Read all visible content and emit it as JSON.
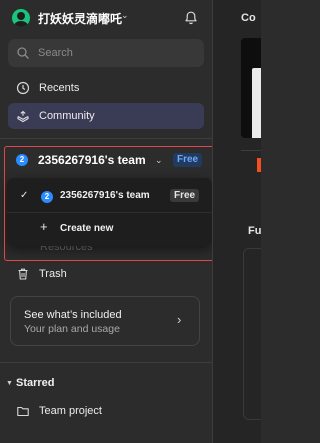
{
  "header": {
    "username": "打妖妖灵滴嘟吒",
    "username_chevron": "⌄"
  },
  "search": {
    "placeholder": "Search"
  },
  "nav": {
    "recents": "Recents",
    "community": "Community"
  },
  "team": {
    "badge_number": "2",
    "name": "2356267916's team",
    "chevron": "⌄",
    "plan_badge": "Free",
    "accent": "#2b8cff"
  },
  "team_dropdown": {
    "selected_check": "✓",
    "team_badge_number": "2",
    "team_name": "2356267916's team",
    "plan_badge": "Free",
    "create_icon": "+",
    "create_label": "Create new"
  },
  "partially_hidden_item": "Resources",
  "trash": "Trash",
  "promo_card": {
    "title": "See what’s included",
    "subtitle": "Your plan and usage",
    "chevron": "›"
  },
  "starred": {
    "chevron": "▼",
    "heading": "Starred",
    "items": [
      {
        "label": "Team project"
      }
    ]
  },
  "right_panel": {
    "top_label": "Co",
    "section_label": "Fu"
  },
  "colors": {
    "sidebar_bg": "#2c2c2c",
    "active_nav_bg": "#3a3b55",
    "highlight_border": "#e0474d",
    "free_badge_text": "#6aa9ff"
  },
  "icons": {
    "avatar": "avatar",
    "bell": "bell-icon",
    "search": "search-icon",
    "recents": "clock-icon",
    "community": "community-icon",
    "trash": "trash-icon",
    "folder": "folder-icon"
  }
}
